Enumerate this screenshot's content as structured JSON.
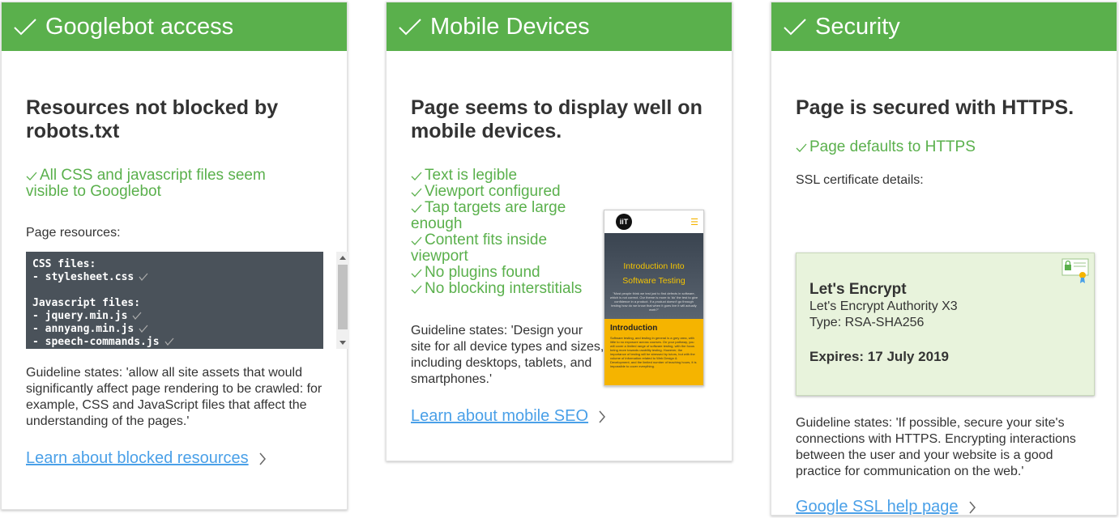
{
  "colors": {
    "header_green": "#5ab04c",
    "pass_green": "#5ab04c",
    "link_blue": "#4aa0e8",
    "code_bg": "#4a525a",
    "cert_bg": "#e8f3dc",
    "phone_accent": "#f5b400"
  },
  "icons": {
    "header_check": "checkmark-icon",
    "item_check": "checkmark-icon",
    "link_chevron": "chevron-right-icon",
    "certificate": "certificate-icon"
  },
  "cards": [
    {
      "header": "Googlebot access",
      "title": "Resources not blocked by robots.txt",
      "pass": "All CSS and javascript files seem visible to Googlebot",
      "resources_label": "Page resources:",
      "code": {
        "css_heading": "CSS files:",
        "css_files": [
          "- stylesheet.css"
        ],
        "js_heading": "Javascript files:",
        "js_files": [
          "- jquery.min.js",
          "- annyang.min.js",
          "- speech-commands.js"
        ]
      },
      "guideline": "Guideline states: 'allow all site assets that would significantly affect page rendering to be crawled: for example, CSS and JavaScript files that affect the understanding of the pages.'",
      "link": "Learn about blocked resources"
    },
    {
      "header": "Mobile Devices",
      "title": "Page seems to display well on mobile devices.",
      "checks": [
        "Text is legible",
        "Viewport configured",
        "Tap targets are large enough",
        "Content fits inside viewport",
        "No plugins found",
        "No blocking interstitials"
      ],
      "preview": {
        "logo": "iiT",
        "hero_title": "Introduction Into Software Testing",
        "hero_text": "\"Most people think we test just to find defects in software, which is not correct. Our theme is more to 'do' the test to give confidence in a product. If a product doesn't go through testing how do we know that when it goes live it will actually work?\"",
        "intro_title": "Introduction",
        "intro_text": "Software testing, and testing in general is a grey area, with little to no exposure across courses. On your pathway, you will cover a limited range of software testing, with the focus being more towards usability testing. However, the importance of testing will be stressed by tutors, but with the volume of information related to Web Design & Development, and the limited number of teaching hours, it is impossible to cover everything."
      },
      "guideline": "Guideline states: 'Design your site for all device types and sizes, including desktops, tablets, and smartphones.'",
      "link": "Learn about mobile SEO"
    },
    {
      "header": "Security",
      "title": "Page is secured with HTTPS.",
      "pass": "Page defaults to HTTPS",
      "ssl_label": "SSL certificate details:",
      "certificate": {
        "issuer": "Let's Encrypt",
        "authority": "Let's Encrypt Authority X3",
        "type": "Type: RSA-SHA256",
        "expires": "Expires: 17 July 2019"
      },
      "guideline": "Guideline states: 'If possible, secure your site's connections with HTTPS. Encrypting interactions between the user and your website is a good practice for communication on the web.'",
      "link": "Google SSL help page"
    }
  ]
}
